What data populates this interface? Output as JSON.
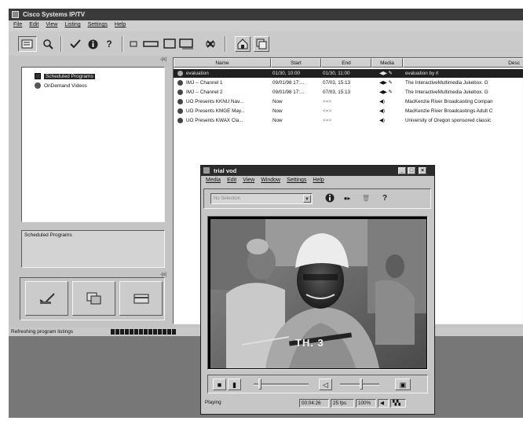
{
  "app": {
    "title": "Cisco Systems IP/TV",
    "menu": [
      "File",
      "Edit",
      "View",
      "Listing",
      "Settings",
      "Help"
    ],
    "toolbar_icons": [
      "programs-icon",
      "search-icon",
      "checkmark-icon",
      "info-icon",
      "help-icon",
      "small-view-icon",
      "wide-view-icon",
      "monitor-view-icon",
      "tv-view-icon",
      "close-view-icon",
      "home-icon",
      "copy-icon"
    ],
    "help_glyph": "?"
  },
  "left_pane": {
    "pin_label": "-|x|",
    "tree": [
      {
        "label": "Scheduled Programs",
        "selected": true
      },
      {
        "label": "OnDemand Videos",
        "selected": false
      }
    ],
    "description": "Scheduled Programs",
    "button_icons": [
      "edit-icon",
      "copy-icon",
      "folder-icon"
    ]
  },
  "list": {
    "columns": [
      "Name",
      "Start",
      "End",
      "Media",
      "Desc"
    ],
    "rows": [
      {
        "name": "evaluation",
        "start": "01/30, 10:00",
        "end": "01/30, 11:00",
        "media": "audio-video",
        "desc": "evaluation by rl",
        "selected": true
      },
      {
        "name": "IMJ -- Channel 1",
        "start": "09/01/98 17:...",
        "end": "07/03, 15:13",
        "media": "audio-video",
        "desc": "The InteractiveMultimedia Jukebox. G",
        "selected": false
      },
      {
        "name": "IMJ -- Channel 2",
        "start": "09/01/98 17:...",
        "end": "07/03, 15:13",
        "media": "audio-video",
        "desc": "The InteractiveMultimedia Jukebox. G",
        "selected": false
      },
      {
        "name": "UO Presents KKNU Nav...",
        "start": "Now",
        "end": "<=>",
        "media": "audio",
        "desc": "MacKenzie River Broadcasting Compan",
        "selected": false
      },
      {
        "name": "UO Presents KMGE May...",
        "start": "Now",
        "end": "<=>",
        "media": "audio",
        "desc": "MacKenzie River Broadcastings Adult C",
        "selected": false
      },
      {
        "name": "UO Presents KWAX Cla...",
        "start": "Now",
        "end": "<=>",
        "media": "audio",
        "desc": "University of Oregon sponsored classic",
        "selected": false
      }
    ]
  },
  "status": {
    "text": "Refreshing program listings",
    "progress_blocks": 14
  },
  "vod": {
    "title": "trial vod",
    "menu": [
      "Media",
      "Edit",
      "View",
      "Window",
      "Settings",
      "Help"
    ],
    "window_buttons": [
      "_",
      "□",
      "×"
    ],
    "combo_placeholder": "No Selection",
    "toolbar_icons": [
      "info-icon",
      "record-icon",
      "trash-icon",
      "help-icon"
    ],
    "help_glyph": "?",
    "caption": "TH. 3",
    "status": {
      "state": "Playing",
      "time": "00:04:26",
      "fps": "25 fps",
      "zoom": "100%"
    }
  }
}
